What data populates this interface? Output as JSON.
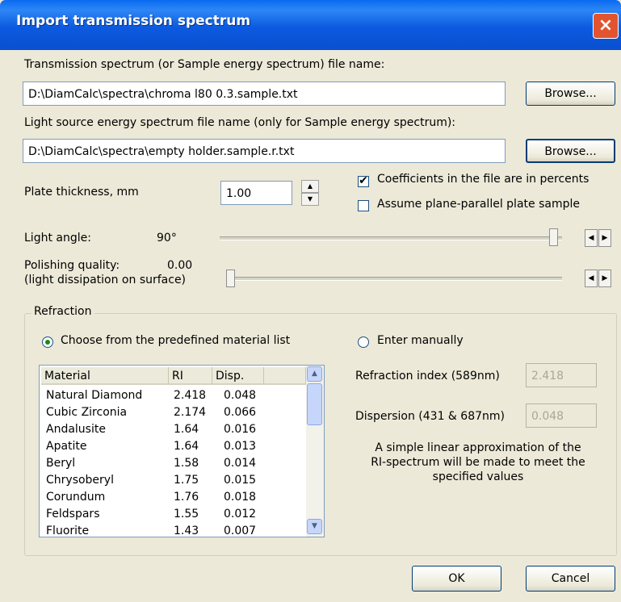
{
  "window": {
    "title": "Import transmission spectrum",
    "close_glyph": "×"
  },
  "transmission": {
    "label": "Transmission spectrum (or Sample energy spectrum) file name:",
    "value": "D:\\DiamCalc\\spectra\\chroma l80 0.3.sample.txt",
    "browse_label": "Browse..."
  },
  "light_source": {
    "label": "Light source energy spectrum file name (only for Sample energy spectrum):",
    "value": "D:\\DiamCalc\\spectra\\empty holder.sample.r.txt",
    "browse_label": "Browse..."
  },
  "plate": {
    "label": "Plate thickness, mm",
    "value": "1.00"
  },
  "options": {
    "coefficients_label": "Coefficients in the file are in percents",
    "coefficients_checked": true,
    "plane_parallel_label": "Assume plane-parallel plate sample",
    "plane_parallel_checked": false
  },
  "light_angle": {
    "label": "Light angle:",
    "value": "90°",
    "slider_level": 1.0
  },
  "polishing": {
    "label_line1": "Polishing quality:",
    "label_line2": "(light dissipation on surface)",
    "value": "0.00",
    "slider_level": 0.0
  },
  "refraction": {
    "group_label": "Refraction",
    "predefined_label": "Choose from the predefined material list",
    "manual_label": "Enter manually",
    "selected": "predefined",
    "columns": [
      "Material",
      "RI",
      "Disp."
    ],
    "rows": [
      [
        "Natural Diamond",
        "2.418",
        "0.048"
      ],
      [
        "Cubic Zirconia",
        "2.174",
        "0.066"
      ],
      [
        "Andalusite",
        "1.64",
        "0.016"
      ],
      [
        "Apatite",
        "1.64",
        "0.013"
      ],
      [
        "Beryl",
        "1.58",
        "0.014"
      ],
      [
        "Chrysoberyl",
        "1.75",
        "0.015"
      ],
      [
        "Corundum",
        "1.76",
        "0.018"
      ],
      [
        "Feldspars",
        "1.55",
        "0.012"
      ],
      [
        "Fluorite",
        "1.43",
        "0.007"
      ]
    ],
    "refraction_index_label": "Refraction index (589nm)",
    "refraction_index_value": "2.418",
    "dispersion_label": "Dispersion (431 & 687nm)",
    "dispersion_value": "0.048",
    "note_line1": "A simple linear approximation of the",
    "note_line2": "RI-spectrum will be made to meet the",
    "note_line3": "specified values"
  },
  "buttons": {
    "ok": "OK",
    "cancel": "Cancel"
  }
}
